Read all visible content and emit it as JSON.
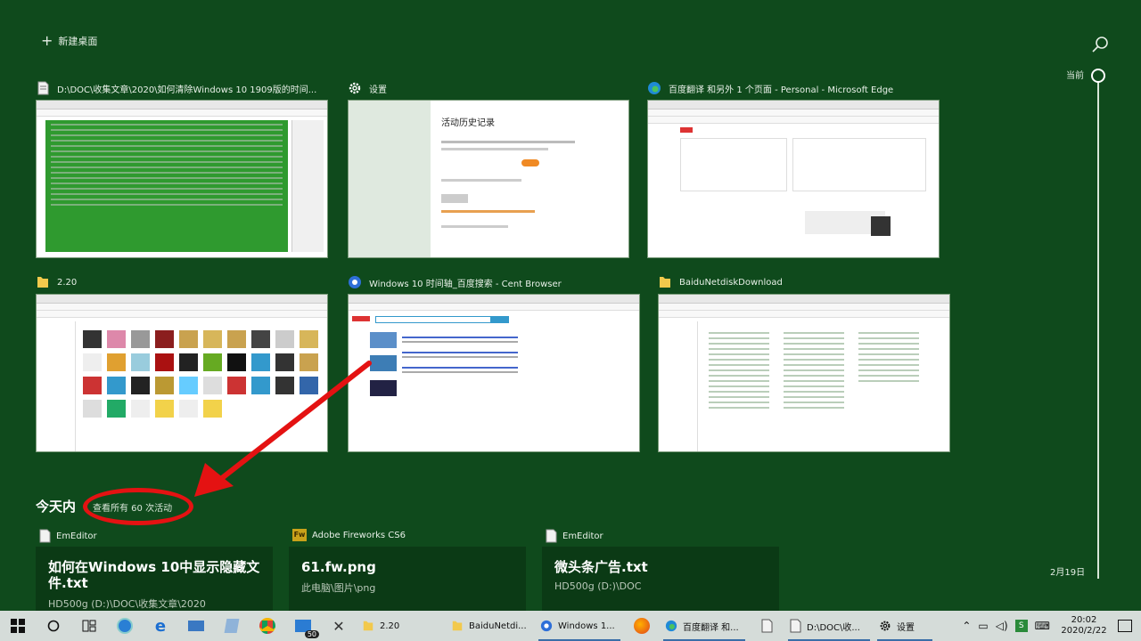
{
  "header": {
    "new_desktop": "新建桌面"
  },
  "timeline": {
    "now": "当前",
    "date": "2月19日"
  },
  "windows": [
    {
      "title": "D:\\DOC\\收集文章\\2020\\如何清除Windows 10 1909版的时间...",
      "icon": "document-icon"
    },
    {
      "title": "设置",
      "icon": "gear-icon",
      "thumb_heading": "活动历史记录"
    },
    {
      "title": "百度翻译 和另外 1 个页面 - Personal - Microsoft Edge",
      "icon": "edge-icon"
    },
    {
      "title": "2.20",
      "icon": "folder-icon"
    },
    {
      "title": "Windows 10 时间轴_百度搜索 - Cent Browser",
      "icon": "browser-icon"
    },
    {
      "title": "BaiduNetdiskDownload",
      "icon": "folder-icon"
    }
  ],
  "today": {
    "label": "今天内",
    "see_all": "查看所有 60 次活动"
  },
  "activities": [
    {
      "app": "EmEditor",
      "title": "如何在Windows 10中显示隐藏文件.txt",
      "sub": "HD500g (D:)\\DOC\\收集文章\\2020"
    },
    {
      "app": "Adobe Fireworks CS6",
      "title": "61.fw.png",
      "sub": "此电脑\\图片\\png"
    },
    {
      "app": "EmEditor",
      "title": "微头条广告.txt",
      "sub": "HD500g (D:)\\DOC"
    }
  ],
  "taskbar": {
    "apps": [
      {
        "label": "2.20"
      },
      {
        "label": "BaiduNetdi..."
      },
      {
        "label": "Windows 1..."
      },
      {
        "label": "百度翻译 和..."
      },
      {
        "label": "D:\\DOC\\收..."
      },
      {
        "label": "设置"
      }
    ],
    "mail_badge": "50",
    "time": "20:02",
    "date": "2020/2/22"
  },
  "colors": {
    "background": "#0f4a1c",
    "annotation": "#e41212",
    "taskbar": "#d5dcd9"
  }
}
